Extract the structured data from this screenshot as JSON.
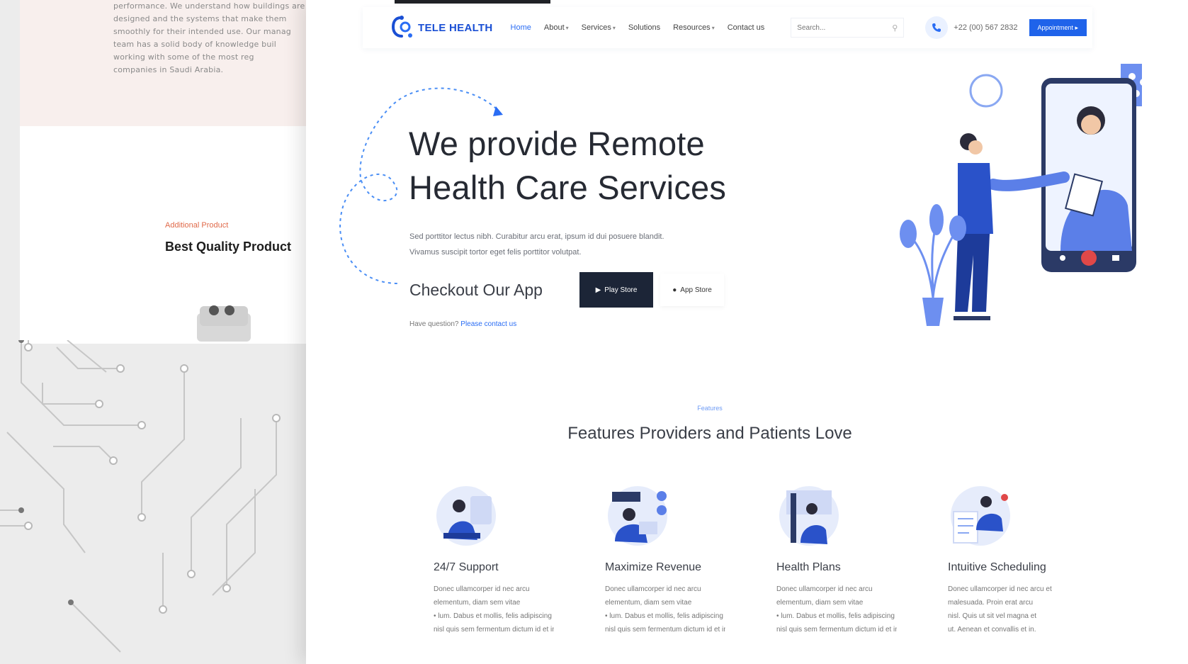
{
  "background_page": {
    "paragraph": [
      "performance. We understand how buildings are",
      "designed and the systems that make them",
      "smoothly for their intended use. Our manag",
      "team has a solid body of knowledge buil",
      "working with some of the most reg",
      "companies in Saudi Arabia."
    ],
    "eyebrow": "Additional Product",
    "heading": "Best Quality Product"
  },
  "nav": {
    "logo_text": "TELE HEALTH",
    "menu": [
      {
        "label": "Home",
        "chevron": ""
      },
      {
        "label": "About",
        "chevron": "▾"
      },
      {
        "label": "Services",
        "chevron": "▾"
      },
      {
        "label": "Solutions",
        "chevron": ""
      },
      {
        "label": "Resources",
        "chevron": "▾"
      },
      {
        "label": "Contact us",
        "chevron": ""
      }
    ],
    "search_placeholder": "Search...",
    "phone_number": "+22 (00) 567 2832",
    "appointment_button": "Appointment ▸"
  },
  "hero": {
    "title_line1": "We provide Remote",
    "title_line2": "Health Care Services",
    "text_line1": "Sed porttitor lectus nibh. Curabitur arcu erat, ipsum id dui posuere blandit.",
    "text_line2": "Vivamus suscipit tortor eget felis porttitor volutpat.",
    "checkout_label": "Checkout Our App",
    "play_store_label": "Play Store",
    "app_store_label": "App Store",
    "question_text": "Have question?",
    "question_link": "Please contact us"
  },
  "features": {
    "eyebrow": "Features",
    "title": "Features Providers and Patients Love",
    "items": [
      {
        "title": "24/7 Support",
        "desc": [
          "Donec ullamcorper id nec arcu",
          "elementum, diam sem vitae",
          "• lum. Dabus et mollis, felis adipiscing",
          "nisl quis sem fermentum dictum id et in."
        ]
      },
      {
        "title": "Maximize Revenue",
        "desc": [
          "Donec ullamcorper id nec arcu",
          "elementum, diam sem vitae",
          "• lum. Dabus et mollis, felis adipiscing",
          "nisl quis sem fermentum dictum id et in."
        ]
      },
      {
        "title": "Health Plans",
        "desc": [
          "Donec ullamcorper id nec arcu",
          "elementum, diam sem vitae",
          "• lum. Dabus et mollis, felis adipiscing",
          "nisl quis sem fermentum dictum id et in."
        ]
      },
      {
        "title": "Intuitive Scheduling",
        "desc": [
          "Donec ullamcorper id nec arcu et",
          "malesuada. Proin erat arcu",
          "nisl. Quis ut sit vel magna et",
          "ut. Aenean et convallis et in."
        ]
      }
    ]
  },
  "colors": {
    "accent_blue": "#1f63ea",
    "dark_navy": "#1c2537",
    "illustration_blue": "#5b7fe8",
    "call_red": "#e04848"
  },
  "icons": [
    "phone-icon",
    "search-icon",
    "play-icon",
    "apple-icon",
    "logo-icon"
  ]
}
